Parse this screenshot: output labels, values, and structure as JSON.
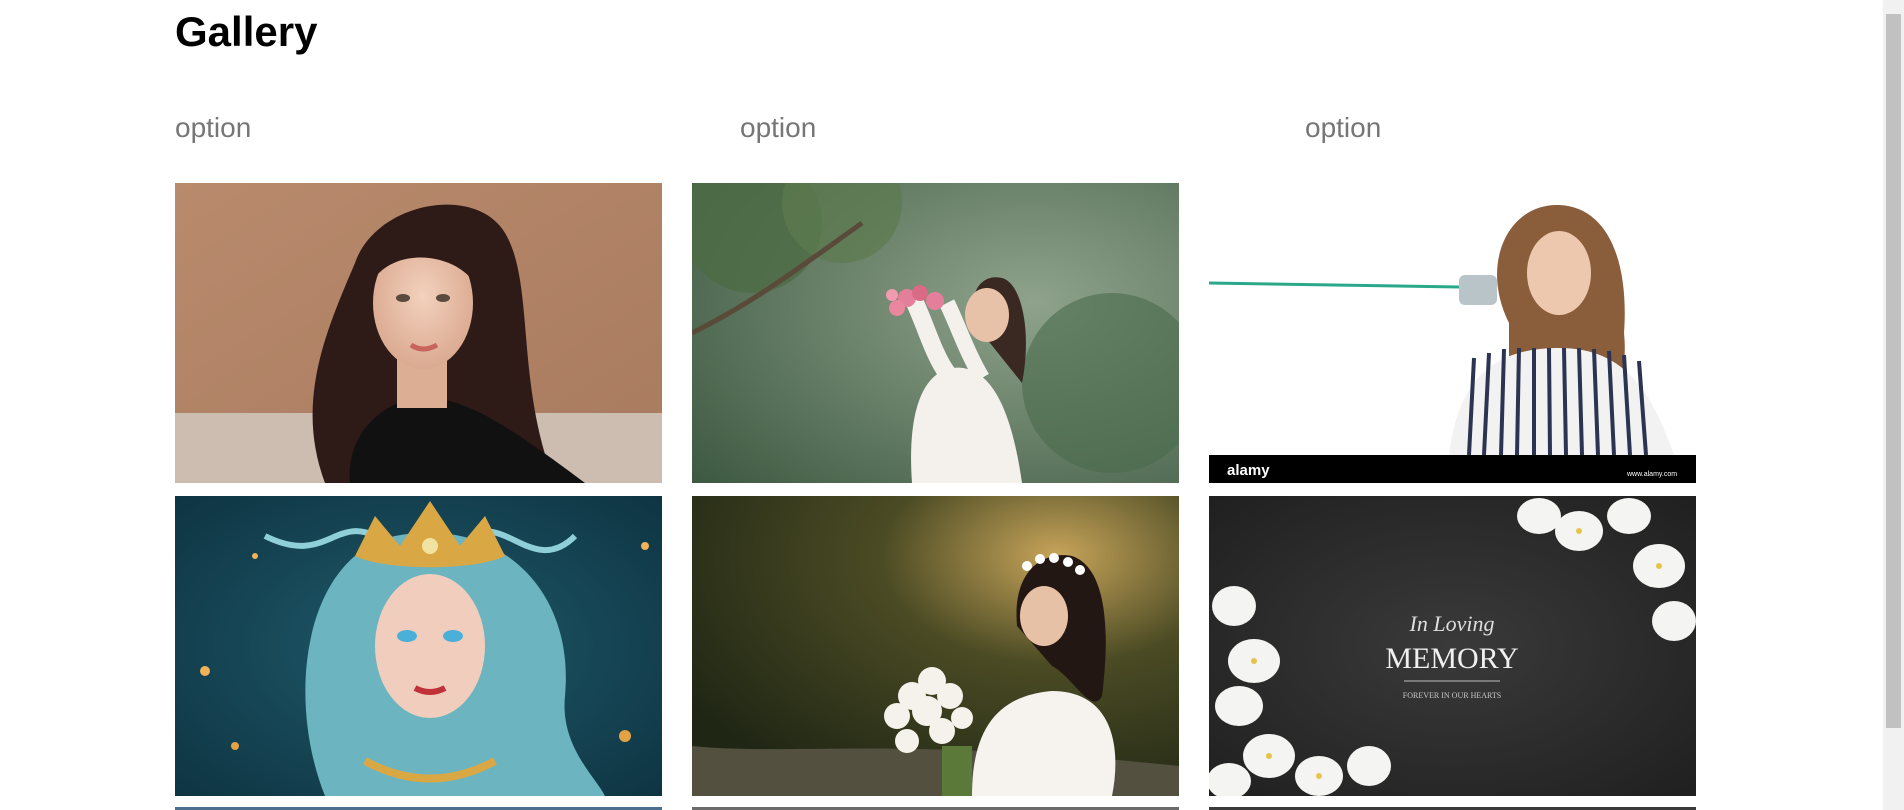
{
  "header": {
    "title": "Gallery"
  },
  "options": [
    {
      "label": "option"
    },
    {
      "label": "option"
    },
    {
      "label": "option"
    }
  ],
  "gallery": {
    "images": [
      {
        "subject": "portrait-woman-black-turtleneck"
      },
      {
        "subject": "woman-white-dress-pink-flowers"
      },
      {
        "subject": "girl-tin-can-phone",
        "watermark": "alamy",
        "stock_url": "www.alamy.com"
      },
      {
        "subject": "fantasy-teal-hair-gold-crown"
      },
      {
        "subject": "woman-flower-crown-bouquet"
      },
      {
        "subject": "memorial-white-orchids",
        "script_text": "In Loving",
        "heading_text": "MEMORY",
        "sub_text": "FOREVER IN OUR HEARTS"
      }
    ]
  },
  "colors": {
    "title": "#000000",
    "option_text": "#767676",
    "scrollbar_track": "#f1f1f1",
    "scrollbar_thumb": "#c1c1c1"
  }
}
